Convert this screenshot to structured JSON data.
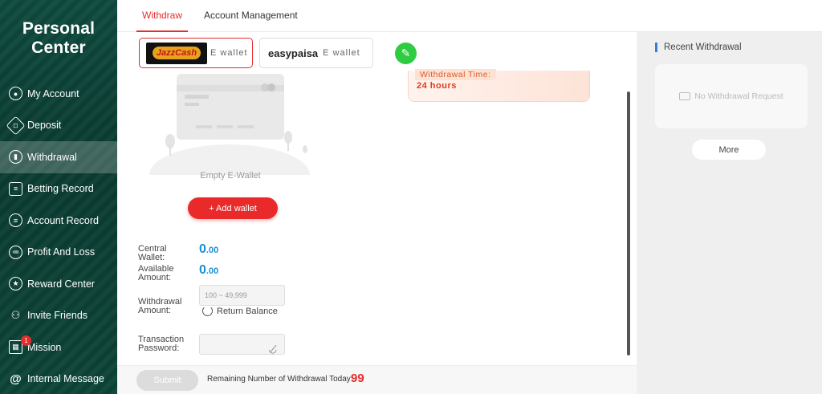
{
  "sidebar": {
    "title_line1": "Personal",
    "title_line2": "Center",
    "items": [
      {
        "label": "My Account",
        "icon": "account-icon"
      },
      {
        "label": "Deposit",
        "icon": "deposit-icon"
      },
      {
        "label": "Withdrawal",
        "icon": "withdrawal-icon"
      },
      {
        "label": "Betting Record",
        "icon": "betting-record-icon"
      },
      {
        "label": "Account Record",
        "icon": "account-record-icon"
      },
      {
        "label": "Profit And Loss",
        "icon": "profit-loss-icon"
      },
      {
        "label": "Reward Center",
        "icon": "reward-icon"
      },
      {
        "label": "Invite Friends",
        "icon": "invite-icon"
      },
      {
        "label": "Mission",
        "icon": "gift-icon",
        "badge": "1"
      },
      {
        "label": "Internal Message",
        "icon": "at-icon"
      }
    ]
  },
  "tabs": {
    "withdraw": "Withdraw",
    "account_management": "Account Management"
  },
  "wallets": {
    "jazzcash_logo": "JazzCash",
    "jazzcash_suffix": "E wallet",
    "easypaisa_logo": "easypaisa",
    "easypaisa_suffix": "E wallet"
  },
  "withdrawal_time": {
    "label": "Withdrawal Time:",
    "value": "24 hours"
  },
  "empty_wallet": {
    "label": "Empty E-Wallet",
    "add_button": "+ Add wallet"
  },
  "form": {
    "central_wallet_label": "Central Wallet:",
    "central_wallet_int": "0",
    "central_wallet_dec": ".00",
    "available_amount_label": "Available Amount:",
    "available_amount_int": "0",
    "available_amount_dec": ".00",
    "withdrawal_amount_label": "Withdrawal Amount:",
    "withdrawal_amount_placeholder": "100 ~ 49,999",
    "return_balance": "Return Balance",
    "transaction_password_label": "Transaction Password:"
  },
  "footer": {
    "submit": "Submit",
    "remaining_label": "Remaining Number of Withdrawal Today:",
    "remaining_count": "99"
  },
  "recent": {
    "title": "Recent Withdrawal",
    "empty_text": "No Withdrawal Request",
    "more": "More"
  },
  "colors": {
    "accent": "#e62c2c",
    "sidebar": "#0f4a3f",
    "amount": "#1b8fd0",
    "edit": "#2ecc40"
  }
}
